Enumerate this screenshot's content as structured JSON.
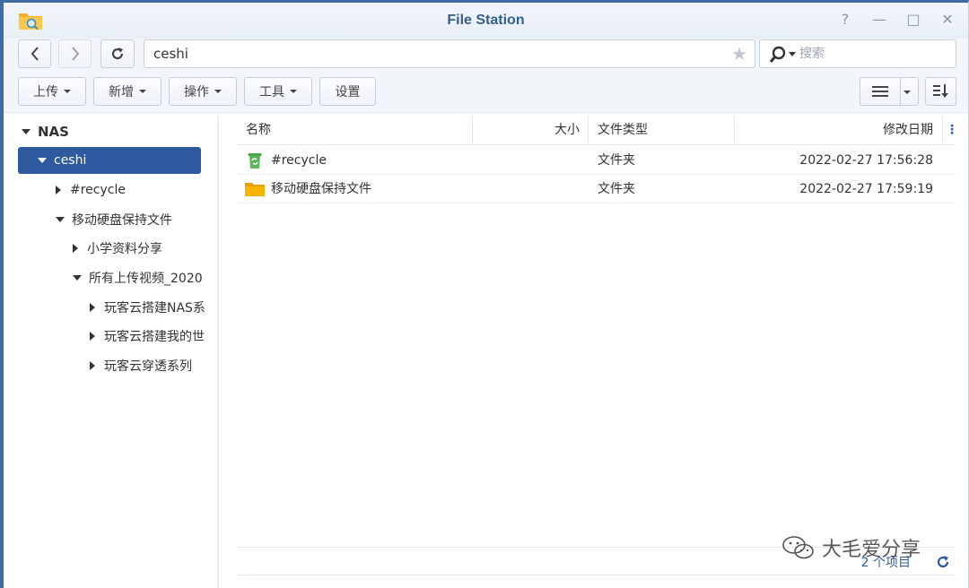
{
  "window": {
    "title": "File Station",
    "controls": [
      "?",
      "—",
      "□",
      "✕"
    ]
  },
  "nav": {
    "path_value": "ceshi",
    "search_placeholder": "搜索"
  },
  "toolbar": {
    "upload_label": "上传",
    "create_label": "新增",
    "action_label": "操作",
    "tools_label": "工具",
    "settings_label": "设置"
  },
  "tree": {
    "root": "NAS",
    "items": [
      {
        "label": "ceshi"
      },
      {
        "label": "#recycle"
      },
      {
        "label": "移动硬盘保持文件"
      },
      {
        "label": "小学资料分享"
      },
      {
        "label": "所有上传视频_2020"
      },
      {
        "label": "玩客云搭建NAS系"
      },
      {
        "label": "玩客云搭建我的世"
      },
      {
        "label": "玩客云穿透系列"
      }
    ]
  },
  "list": {
    "columns": {
      "name": "名称",
      "size": "大小",
      "type": "文件类型",
      "modified": "修改日期",
      "more": "⋮"
    },
    "rows": [
      {
        "name": "#recycle",
        "size": "",
        "type": "文件夹",
        "modified": "2022-02-27 17:56:28",
        "icon": "recycle-folder-icon"
      },
      {
        "name": "移动硬盘保持文件",
        "size": "",
        "type": "文件夹",
        "modified": "2022-02-27 17:59:19",
        "icon": "folder-icon"
      }
    ],
    "item_count": "2 个项目"
  },
  "watermark": {
    "text": "大毛爱分享"
  },
  "colors": {
    "accent": "#2e5aa0",
    "title": "#345e8d",
    "folder": "#f5b400",
    "recycle": "#5bb55b"
  }
}
